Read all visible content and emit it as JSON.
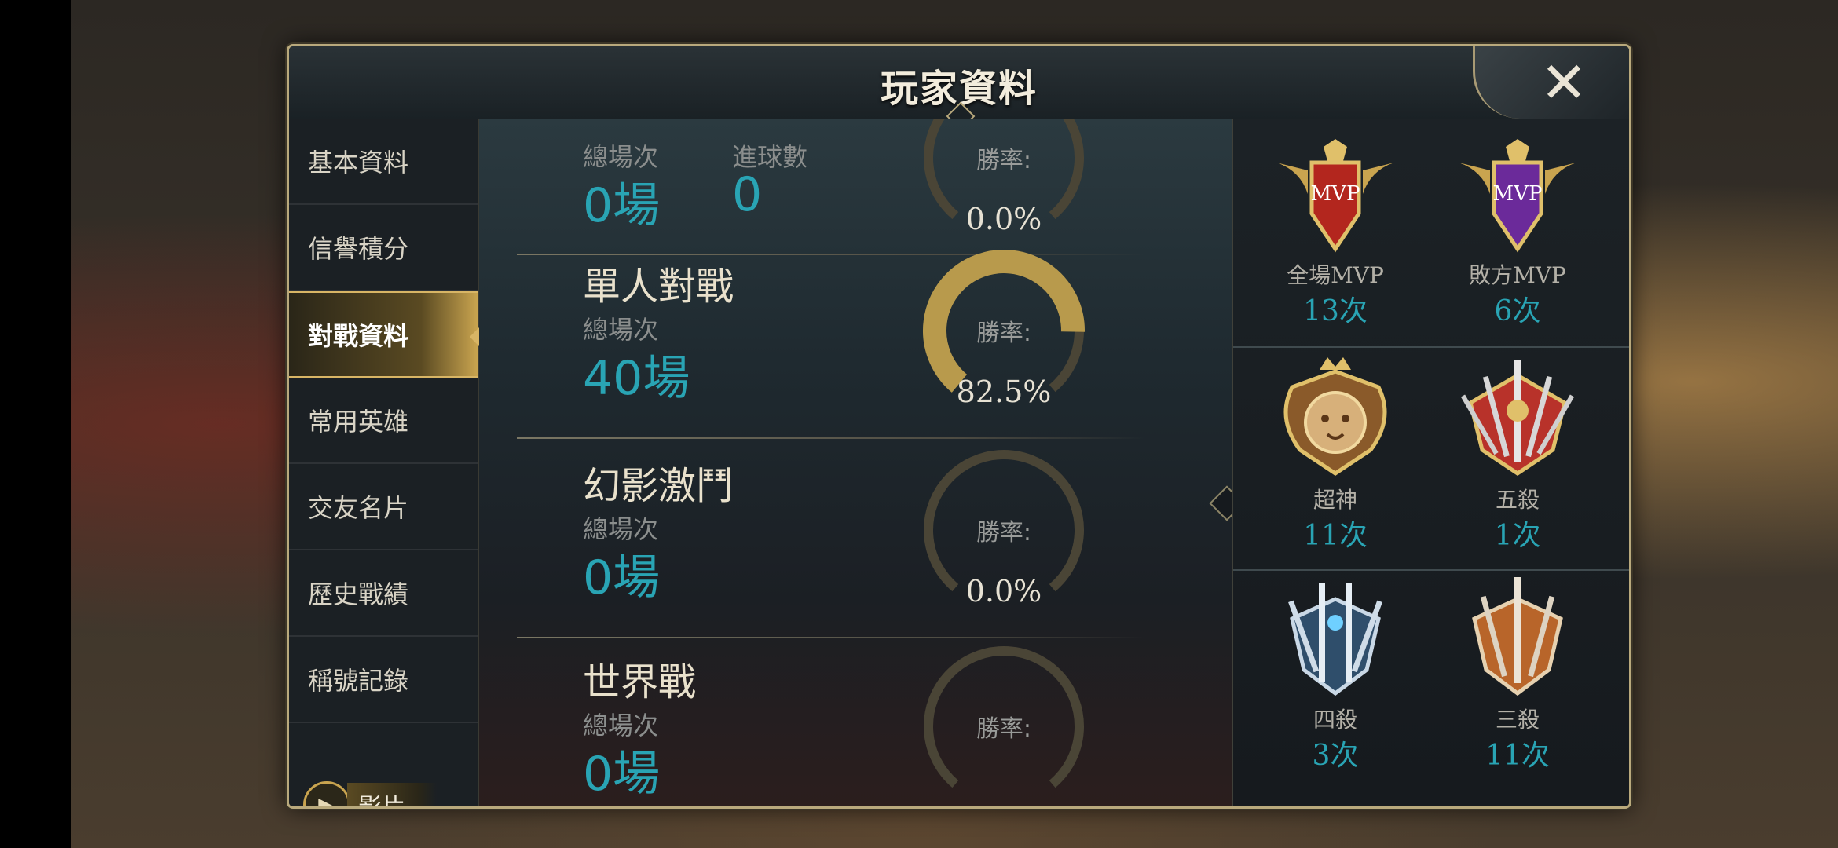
{
  "dialog": {
    "title": "玩家資料",
    "close_label": "✕"
  },
  "sidebar": {
    "items": [
      {
        "label": "基本資料",
        "active": false
      },
      {
        "label": "信譽積分",
        "active": false
      },
      {
        "label": "對戰資料",
        "active": true
      },
      {
        "label": "常用英雄",
        "active": false
      },
      {
        "label": "交友名片",
        "active": false
      },
      {
        "label": "歷史戰績",
        "active": false
      },
      {
        "label": "稱號記錄",
        "active": false
      }
    ],
    "video_label": "影片"
  },
  "stats": {
    "summary": {
      "total_label": "總場次",
      "total_value": "0場",
      "goals_label": "進球數",
      "goals_value": "0",
      "winrate_label": "勝率:",
      "winrate_value": "0.0%",
      "winrate_fraction": 0.0
    },
    "modes": [
      {
        "name": "單人對戰",
        "total_label": "總場次",
        "total_value": "40場",
        "winrate_label": "勝率:",
        "winrate_value": "82.5%",
        "winrate_fraction": 0.825
      },
      {
        "name": "幻影激鬥",
        "total_label": "總場次",
        "total_value": "0場",
        "winrate_label": "勝率:",
        "winrate_value": "0.0%",
        "winrate_fraction": 0.0
      },
      {
        "name": "世界戰",
        "total_label": "總場次",
        "total_value": "0場",
        "winrate_label": "勝率:",
        "winrate_value": "",
        "winrate_fraction": 0.0
      }
    ]
  },
  "awards": [
    {
      "name": "全場MVP",
      "count": "13次",
      "icon": "mvp-red-badge-icon",
      "badge_text": "MVP",
      "color": "#b3261e"
    },
    {
      "name": "敗方MVP",
      "count": "6次",
      "icon": "mvp-purple-badge-icon",
      "badge_text": "MVP",
      "color": "#6b2a9a"
    },
    {
      "name": "超神",
      "count": "11次",
      "icon": "lion-crest-icon",
      "color": "#c8913f"
    },
    {
      "name": "五殺",
      "count": "1次",
      "icon": "five-swords-crest-icon",
      "color": "#b8322a"
    },
    {
      "name": "四殺",
      "count": "3次",
      "icon": "four-swords-crest-icon",
      "color": "#4f9fd3"
    },
    {
      "name": "三殺",
      "count": "11次",
      "icon": "three-swords-crest-icon",
      "color": "#b8652a"
    }
  ],
  "colors": {
    "accent_gold": "#c9a44f",
    "value_teal": "#29a4b4"
  }
}
